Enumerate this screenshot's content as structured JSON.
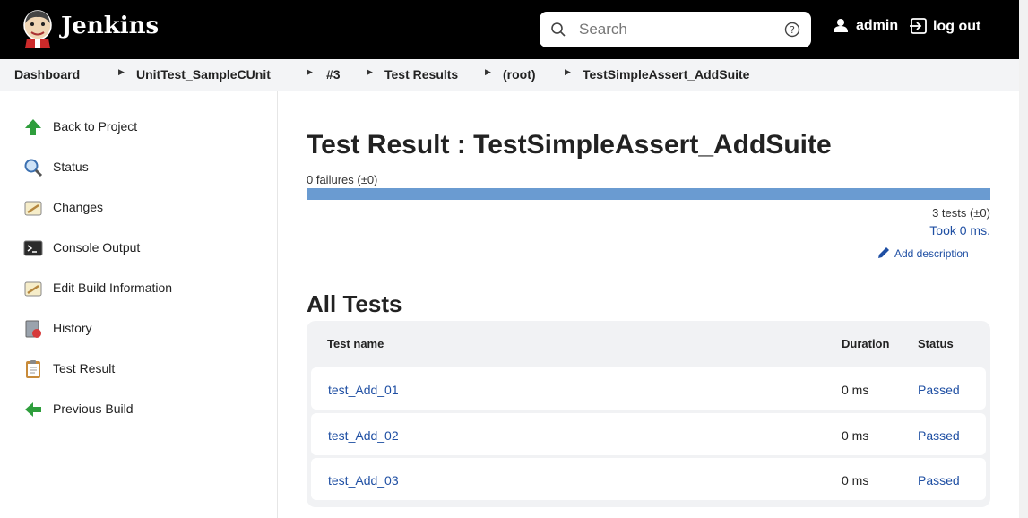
{
  "header": {
    "brand": "Jenkins",
    "search_placeholder": "Search",
    "user": "admin",
    "logout": "log out"
  },
  "breadcrumb": [
    "Dashboard",
    "UnitTest_SampleCUnit",
    "#3",
    "Test Results",
    "(root)",
    "TestSimpleAssert_AddSuite"
  ],
  "sidebar": {
    "items": [
      {
        "label": "Back to Project",
        "icon": "up-arrow-icon"
      },
      {
        "label": "Status",
        "icon": "magnifier-icon"
      },
      {
        "label": "Changes",
        "icon": "notepad-icon"
      },
      {
        "label": "Console Output",
        "icon": "terminal-icon"
      },
      {
        "label": "Edit Build Information",
        "icon": "notepad-edit-icon"
      },
      {
        "label": "History",
        "icon": "history-icon"
      },
      {
        "label": "Test Result",
        "icon": "clipboard-icon"
      },
      {
        "label": "Previous Build",
        "icon": "left-arrow-icon"
      }
    ]
  },
  "main": {
    "title": "Test Result : TestSimpleAssert_AddSuite",
    "failures": "0 failures (±0)",
    "pass_fraction": 1.0,
    "tests_count": "3 tests (±0)",
    "took": "Took 0 ms.",
    "add_description": "Add description",
    "all_tests_heading": "All Tests",
    "table": {
      "headers": [
        "Test name",
        "Duration",
        "Status"
      ],
      "rows": [
        {
          "name": "test_Add_01",
          "duration": "0 ms",
          "status": "Passed"
        },
        {
          "name": "test_Add_02",
          "duration": "0 ms",
          "status": "Passed"
        },
        {
          "name": "test_Add_03",
          "duration": "0 ms",
          "status": "Passed"
        }
      ]
    }
  },
  "colors": {
    "header_bg": "#000000",
    "link": "#1f4fa3",
    "bar": "#6a9bd1"
  }
}
